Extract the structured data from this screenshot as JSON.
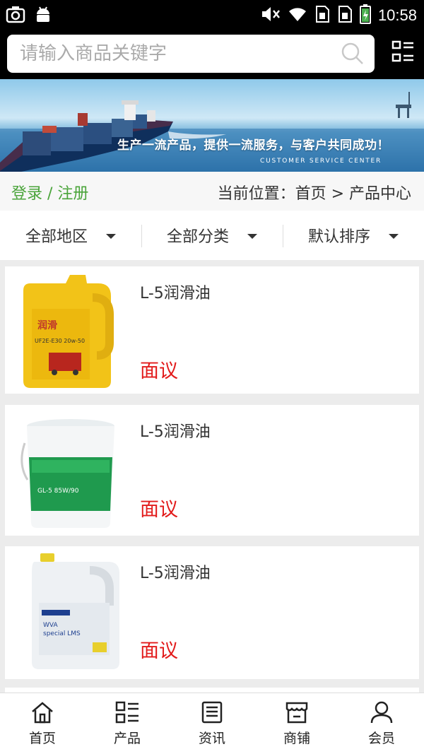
{
  "status_bar": {
    "time": "10:58",
    "left_icons": [
      "camera-icon",
      "android-icon"
    ],
    "right_icons": [
      "mute-icon",
      "wifi-icon",
      "sim1-icon",
      "sim2-icon",
      "battery-icon"
    ]
  },
  "search": {
    "placeholder": "请输入商品关键字",
    "value": ""
  },
  "banner": {
    "slogan": "生产一流产品，提供一流服务，与客户共同成功！",
    "subslogan": "CUSTOMER SERVICE CENTER"
  },
  "info_bar": {
    "login_register": "登录 / 注册",
    "location": "当前位置：首页 > 产品中心"
  },
  "filters": [
    {
      "label": "全部地区"
    },
    {
      "label": "全部分类"
    },
    {
      "label": "默认排序"
    }
  ],
  "products": [
    {
      "name": "L-5润滑油",
      "price": "面议",
      "image": "yellow-oil-jug"
    },
    {
      "name": "L-5润滑油",
      "price": "面议",
      "image": "green-oil-bucket"
    },
    {
      "name": "L-5润滑油",
      "price": "面议",
      "image": "white-oil-bottle"
    }
  ],
  "tabs": [
    {
      "label": "首页",
      "icon": "home-icon"
    },
    {
      "label": "产品",
      "icon": "list-icon"
    },
    {
      "label": "资讯",
      "icon": "news-icon"
    },
    {
      "label": "商铺",
      "icon": "shop-icon"
    },
    {
      "label": "会员",
      "icon": "user-icon"
    }
  ],
  "colors": {
    "accent_green": "#4aa43a",
    "price_red": "#e21b1b",
    "header_black": "#000000"
  }
}
